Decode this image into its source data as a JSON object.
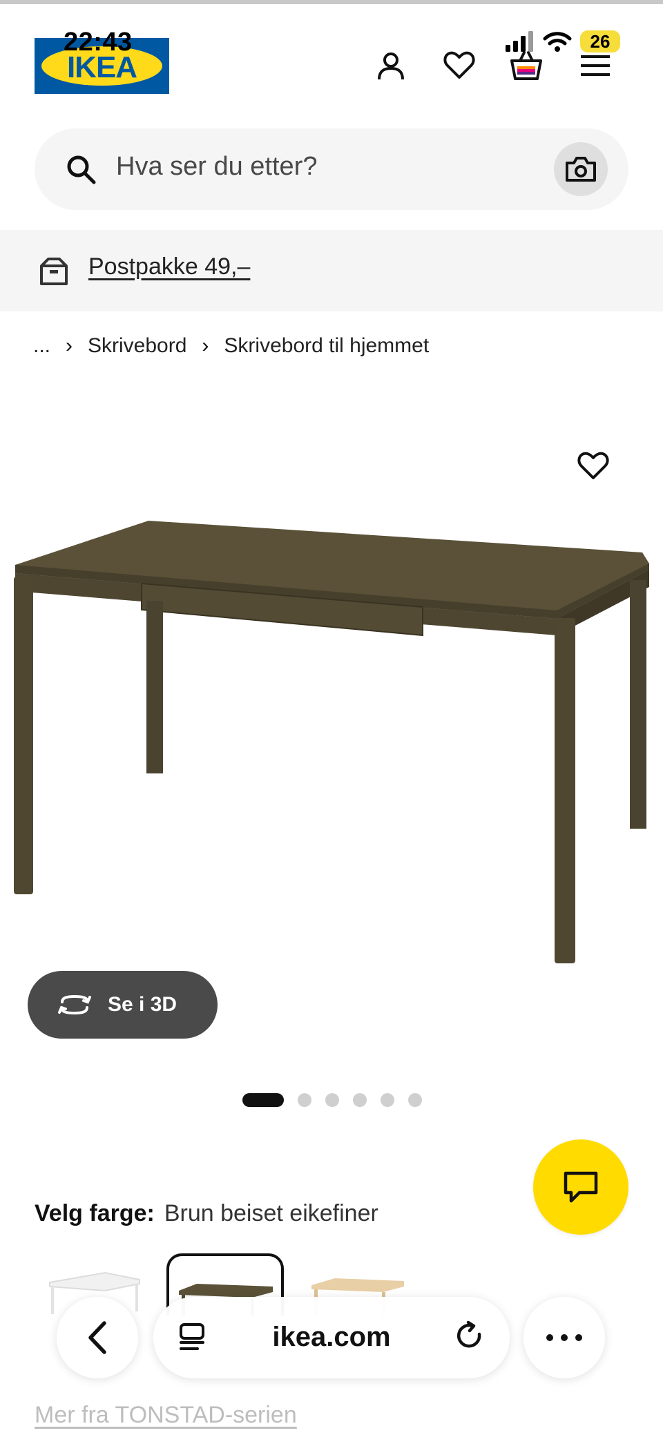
{
  "status_bar": {
    "time": "22:43",
    "battery": "26"
  },
  "header": {
    "logo": "IKEA"
  },
  "search": {
    "placeholder": "Hva ser du etter?"
  },
  "banner": {
    "link": "Postpakke 49,–"
  },
  "breadcrumb": {
    "ellipsis": "...",
    "items": [
      "Skrivebord",
      "Skrivebord til hjemmet"
    ]
  },
  "product": {
    "view_3d_label": "Se i 3D",
    "image_count": 6,
    "active_image": 1,
    "color_label": "Velg farge:",
    "color_value": "Brun beiset eikefiner",
    "series_link": "Mer fra TONSTAD-serien"
  },
  "browser": {
    "url": "ikea.com"
  },
  "colors": {
    "ikea_blue": "#0058a3",
    "ikea_yellow": "#ffda1a",
    "chat_yellow": "#ffdb00",
    "desk_brown": "#4f4730"
  }
}
